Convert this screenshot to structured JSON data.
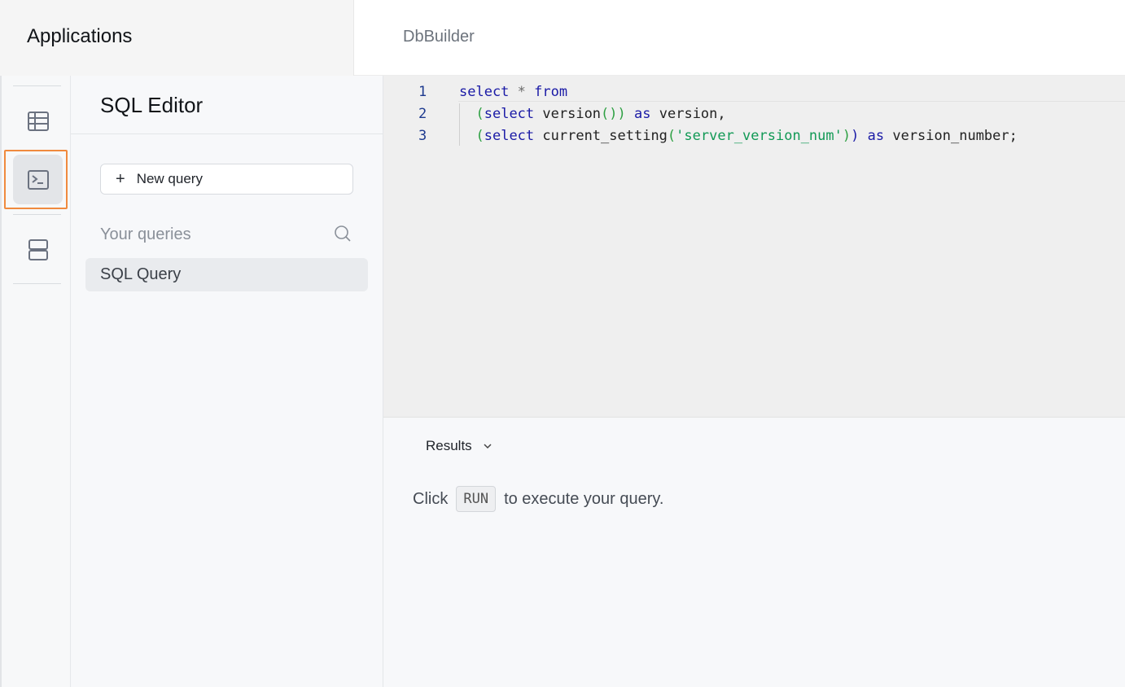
{
  "header": {
    "app_title": "Applications",
    "breadcrumb": "DbBuilder"
  },
  "rail": {
    "items": [
      {
        "name": "table-icon",
        "active": false
      },
      {
        "name": "terminal-icon",
        "active": true
      },
      {
        "name": "database-icon",
        "active": false
      }
    ]
  },
  "panel": {
    "title": "SQL Editor",
    "new_query_label": "New query",
    "your_queries_label": "Your queries",
    "queries": [
      "SQL Query"
    ]
  },
  "editor": {
    "line_numbers": [
      "1",
      "2",
      "3"
    ],
    "lines": [
      "select * from",
      "  (select version()) as version,",
      "  (select current_setting('server_version_num')) as version_number;"
    ]
  },
  "results": {
    "tab_label": "Results",
    "hint_before": "Click",
    "hint_key": "RUN",
    "hint_after": "to execute your query."
  },
  "colors": {
    "focus_outline": "#f08a3e",
    "keyword": "#1a1aa6",
    "string": "#119955"
  }
}
